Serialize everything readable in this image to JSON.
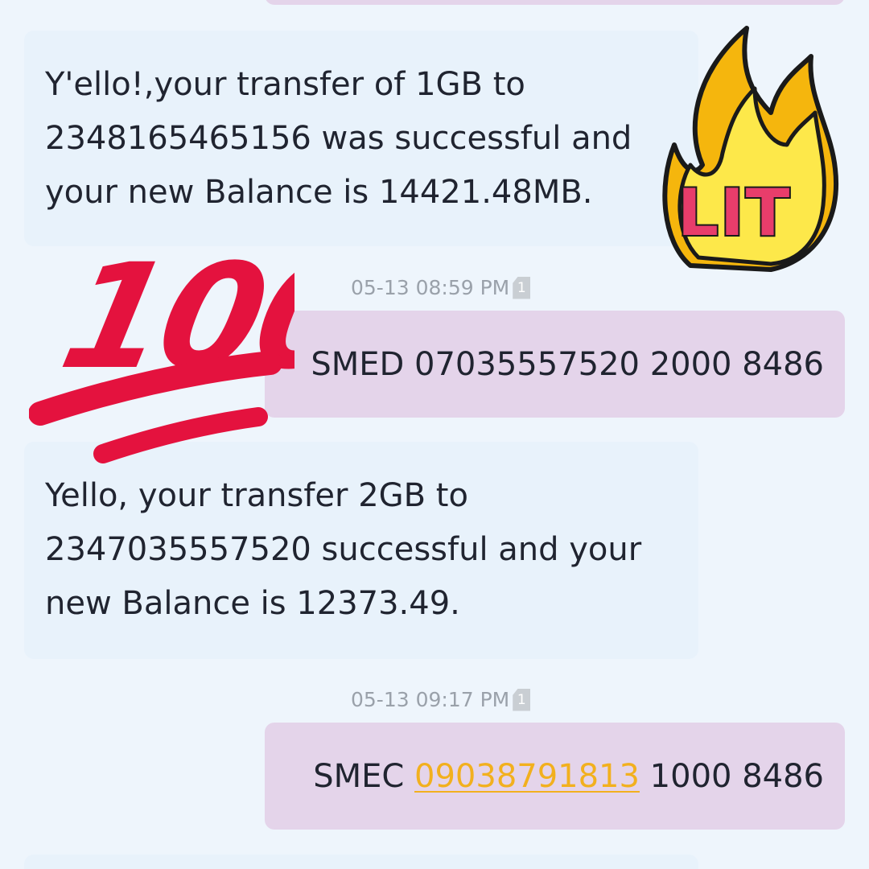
{
  "conversation": {
    "messages": [
      {
        "direction": "incoming",
        "lines": [
          "Y'ello!,your transfer of 1GB to",
          "2348165465156 was successful and",
          "your new Balance is 14421.48MB."
        ]
      },
      {
        "direction": "outgoing",
        "timestamp": "05-13 08:59 PM",
        "sim_slot": "1",
        "text": "SMED 07035557520 2000 8486"
      },
      {
        "direction": "incoming",
        "lines": [
          "Yello, your transfer 2GB to",
          "2347035557520 successful and your",
          "new Balance is 12373.49."
        ]
      },
      {
        "direction": "outgoing",
        "timestamp": "05-13 09:17 PM",
        "sim_slot": "1",
        "text_prefix": "SMEC ",
        "text_link": "09038791813",
        "text_suffix": " 1000 8486"
      }
    ]
  },
  "stickers": {
    "hundred": {
      "icon": "hundred-points-icon",
      "text": "100",
      "color": "#e4123e"
    },
    "lit": {
      "icon": "lit-fire-icon",
      "text": "LIT",
      "flame_color": "#f5b60d",
      "inner_color": "#fde84a",
      "text_color": "#e83d6b"
    }
  },
  "colors": {
    "background": "#eef5fc",
    "incoming_bubble": "#e8f2fb",
    "outgoing_bubble": "#e4d4ea",
    "link": "#f2b01e",
    "timestamp": "#9aa1aa"
  }
}
